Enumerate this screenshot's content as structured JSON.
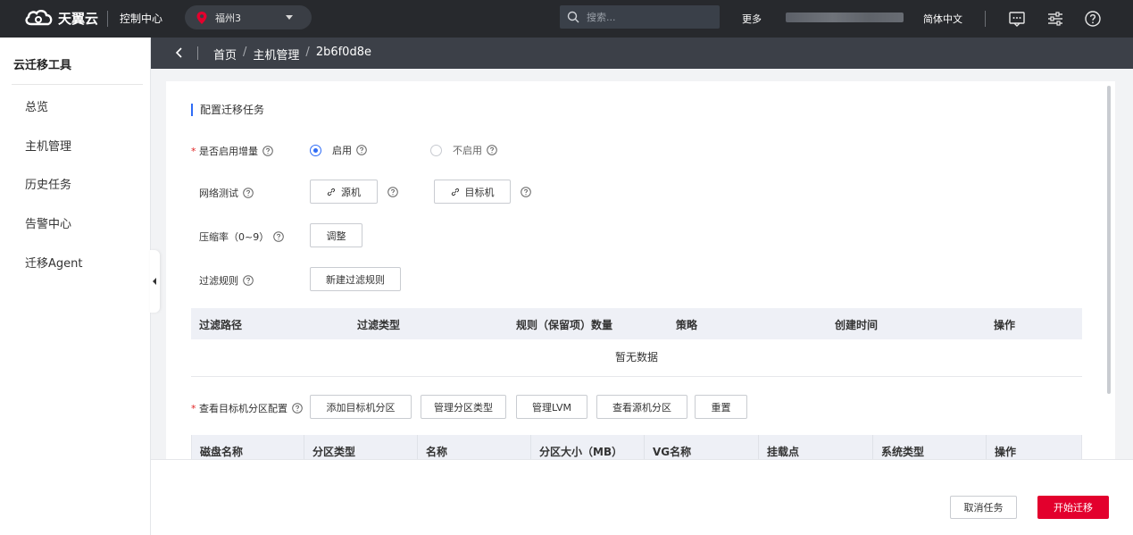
{
  "brand": {
    "name": "天翼云",
    "console": "控制中心"
  },
  "topbar": {
    "region": "福州3",
    "search_placeholder": "搜索...",
    "more": "更多",
    "language": "简体中文",
    "icons": [
      "message-icon",
      "settings-sliders-icon",
      "help-icon"
    ]
  },
  "sidebar": {
    "title": "云迁移工具",
    "items": [
      {
        "label": "总览"
      },
      {
        "label": "主机管理"
      },
      {
        "label": "历史任务"
      },
      {
        "label": "告警中心"
      },
      {
        "label": "迁移Agent"
      }
    ]
  },
  "breadcrumb": {
    "home": "首页",
    "section": "主机管理",
    "current": "2b6f0d8e",
    "separator": "/"
  },
  "form": {
    "section_title": "配置迁移任务",
    "incremental": {
      "label": "是否启用增量",
      "required": "*",
      "options": [
        {
          "label": "启用",
          "selected": true
        },
        {
          "label": "不启用",
          "selected": false
        }
      ]
    },
    "network_test": {
      "label": "网络测试",
      "source_button": "源机",
      "target_button": "目标机"
    },
    "compression": {
      "label": "压缩率（0~9）",
      "button": "调整"
    },
    "filter": {
      "label": "过滤规则",
      "button": "新建过滤规则"
    }
  },
  "filter_table": {
    "columns": [
      "过滤路径",
      "过滤类型",
      "规则（保留项）数量",
      "策略",
      "创建时间",
      "操作"
    ],
    "empty_text": "暂无数据"
  },
  "partition": {
    "label": "查看目标机分区配置",
    "required": "*",
    "buttons": [
      "添加目标机分区",
      "管理分区类型",
      "管理LVM",
      "查看源机分区",
      "重置"
    ]
  },
  "partition_table": {
    "columns": [
      "磁盘名称",
      "分区类型",
      "名称",
      "分区大小（MB）",
      "VG名称",
      "挂载点",
      "系统类型",
      "操作"
    ]
  },
  "footer": {
    "cancel": "取消任务",
    "start": "开始迁移"
  },
  "colors": {
    "accent": "#2f6cf6",
    "danger": "#e3002d",
    "topbar": "#27292d"
  }
}
